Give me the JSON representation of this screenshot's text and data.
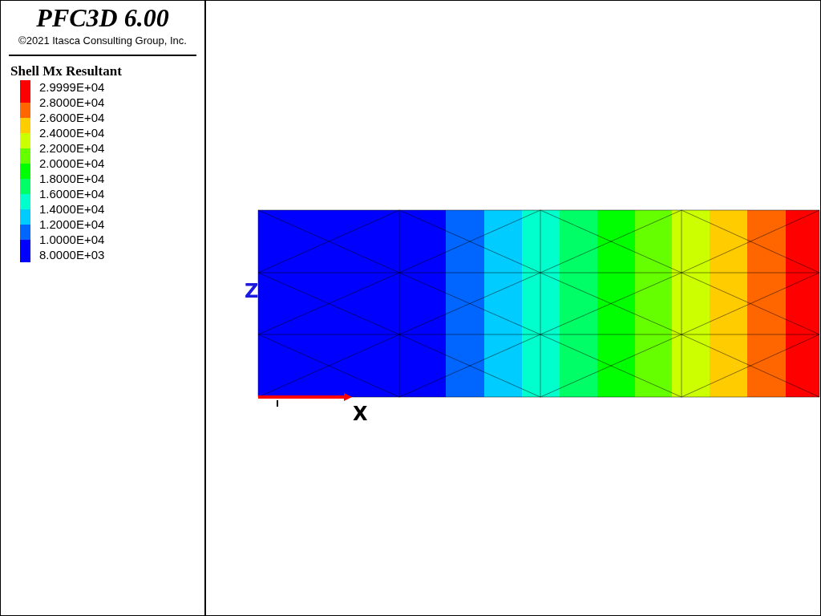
{
  "title": "PFC3D 6.00",
  "copyright": "©2021 Itasca Consulting Group, Inc.",
  "legend": {
    "title": "Shell Mx Resultant",
    "labels": [
      "2.9999E+04",
      "2.8000E+04",
      "2.6000E+04",
      "2.4000E+04",
      "2.2000E+04",
      "2.0000E+04",
      "1.8000E+04",
      "1.6000E+04",
      "1.4000E+04",
      "1.2000E+04",
      "1.0000E+04",
      "8.0000E+03"
    ],
    "bands": [
      {
        "color": "#ff0000"
      },
      {
        "color": "#ff6600"
      },
      {
        "color": "#ffcc00"
      },
      {
        "color": "#ccff00"
      },
      {
        "color": "#66ff00"
      },
      {
        "color": "#00ff00"
      },
      {
        "color": "#00ff66"
      },
      {
        "color": "#00ffcc"
      },
      {
        "color": "#00ccff"
      },
      {
        "color": "#0066ff"
      },
      {
        "color": "#0000ff"
      }
    ]
  },
  "axes": {
    "x_label": "X",
    "z_label": "Z"
  }
}
